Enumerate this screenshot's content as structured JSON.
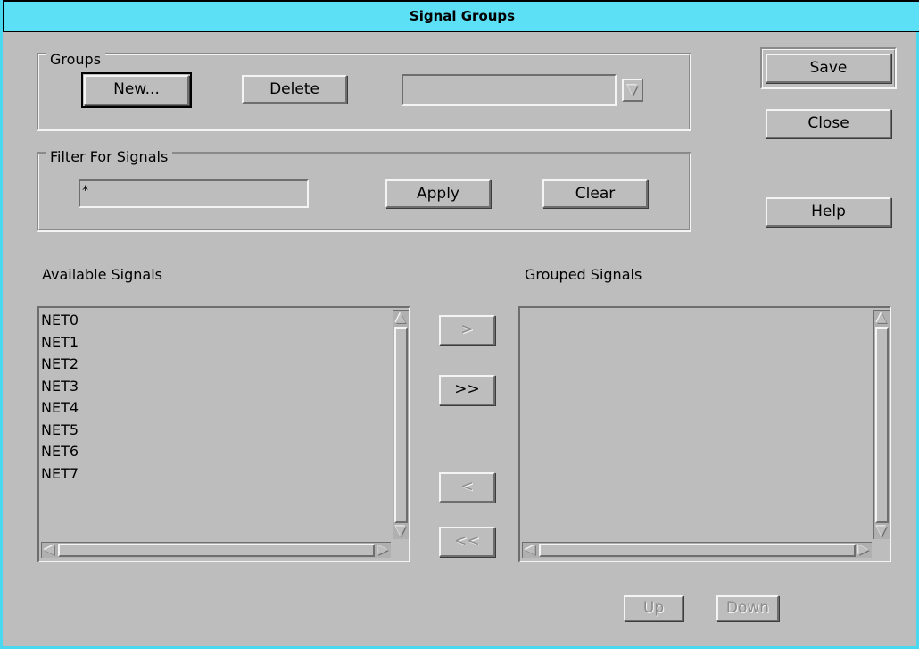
{
  "window": {
    "title": "Signal Groups"
  },
  "groups": {
    "legend": "Groups",
    "new_label": "New...",
    "delete_label": "Delete",
    "combo_value": ""
  },
  "filter": {
    "legend": "Filter For Signals",
    "value": "*",
    "apply_label": "Apply",
    "clear_label": "Clear"
  },
  "actions": {
    "save_label": "Save",
    "close_label": "Close",
    "help_label": "Help"
  },
  "available": {
    "label": "Available Signals",
    "items": [
      "NET0",
      "NET1",
      "NET2",
      "NET3",
      "NET4",
      "NET5",
      "NET6",
      "NET7"
    ]
  },
  "grouped": {
    "label": "Grouped Signals",
    "items": []
  },
  "transfer": {
    "add_label": ">",
    "add_all_label": ">>",
    "remove_label": "<",
    "remove_all_label": "<<"
  },
  "order": {
    "up_label": "Up",
    "down_label": "Down"
  }
}
